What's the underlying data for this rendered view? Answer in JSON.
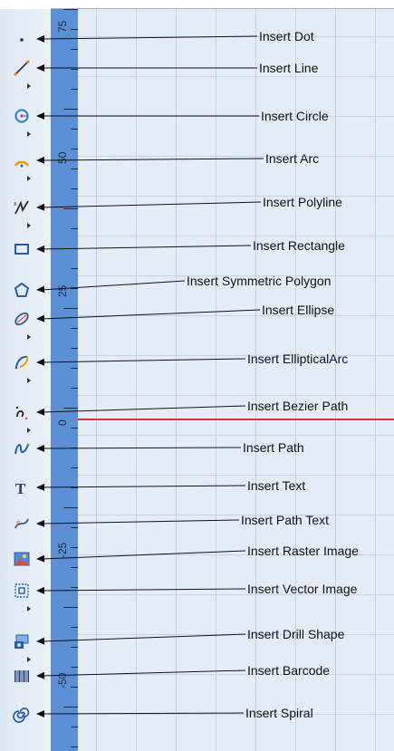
{
  "ruler_labels": [
    "75",
    "50",
    "25",
    "0",
    "-25",
    "-50"
  ],
  "tools": [
    {
      "icon": "dot-icon",
      "label": "Insert Dot",
      "flyout": false
    },
    {
      "icon": "line-icon",
      "label": "Insert Line",
      "flyout": true
    },
    {
      "icon": "circle-icon",
      "label": "Insert Circle",
      "flyout": true
    },
    {
      "icon": "arc-icon",
      "label": "Insert Arc",
      "flyout": true
    },
    {
      "icon": "polyline-icon",
      "label": "Insert Polyline",
      "flyout": true
    },
    {
      "icon": "rectangle-icon",
      "label": "Insert Rectangle",
      "flyout": false
    },
    {
      "icon": "polygon-icon",
      "label": "Insert Symmetric Polygon",
      "flyout": false
    },
    {
      "icon": "ellipse-icon",
      "label": "Insert Ellipse",
      "flyout": true
    },
    {
      "icon": "elliptical-arc-icon",
      "label": "Insert EllipticalArc",
      "flyout": true
    },
    {
      "icon": "bezier-path-icon",
      "label": "Insert Bezier Path",
      "flyout": true
    },
    {
      "icon": "path-icon",
      "label": "Insert Path",
      "flyout": false
    },
    {
      "icon": "text-icon",
      "label": "Insert Text",
      "flyout": false
    },
    {
      "icon": "path-text-icon",
      "label": "Insert Path Text",
      "flyout": false
    },
    {
      "icon": "raster-image-icon",
      "label": "Insert Raster Image",
      "flyout": false
    },
    {
      "icon": "vector-image-icon",
      "label": "Insert Vector Image",
      "flyout": true
    },
    {
      "icon": "drill-shape-icon",
      "label": "Insert Drill Shape",
      "flyout": true
    },
    {
      "icon": "barcode-icon",
      "label": "Insert Barcode",
      "flyout": false
    },
    {
      "icon": "spiral-icon",
      "label": "Insert Spiral",
      "flyout": false
    }
  ],
  "colors": {
    "ruler": "#5b8fd6",
    "canvas": "#e4ecf7",
    "grid": "#c9d3df",
    "guide_line": "#e0312b",
    "toolbar": "#e4edf7"
  }
}
